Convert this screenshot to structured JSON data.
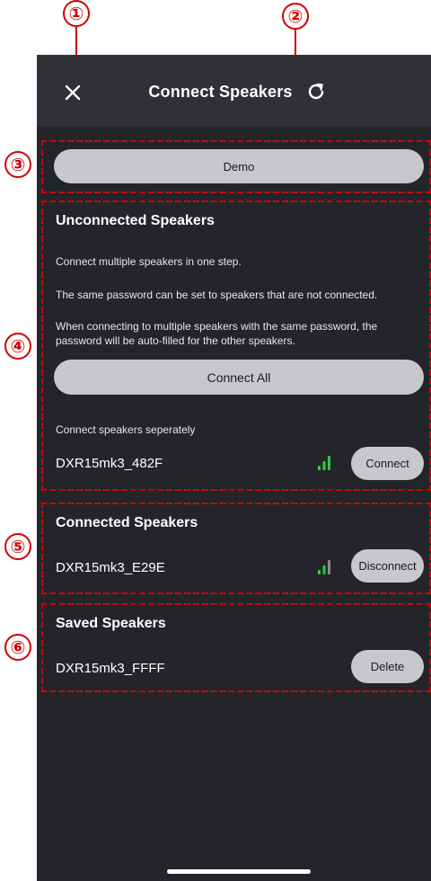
{
  "callouts": [
    "①",
    "②",
    "③",
    "④",
    "⑤",
    "⑥"
  ],
  "header": {
    "title": "Connect Speakers",
    "close_icon": "close-icon",
    "refresh_icon": "refresh-icon"
  },
  "demo": {
    "label": "Demo"
  },
  "unconnected": {
    "title": "Unconnected Speakers",
    "description1": "Connect multiple speakers in one step.",
    "description2": "The same password can be set to speakers that are not connected.",
    "description3": "When connecting to multiple speakers with the same password, the password will be auto-filled for the other speakers.",
    "connect_all_label": "Connect All",
    "separately_label": "Connect speakers seperately",
    "speakers": [
      {
        "name": "DXR15mk3_482F",
        "action": "Connect",
        "signal": "strong"
      }
    ]
  },
  "connected": {
    "title": "Connected Speakers",
    "speakers": [
      {
        "name": "DXR15mk3_E29E",
        "action": "Disconnect",
        "signal": "medium"
      }
    ]
  },
  "saved": {
    "title": "Saved Speakers",
    "speakers": [
      {
        "name": "DXR15mk3_FFFF",
        "action": "Delete"
      }
    ]
  },
  "colors": {
    "accent_red": "#d00000",
    "signal_green": "#2ecc40",
    "signal_gray": "#8a8a8e",
    "background": "#24252a"
  }
}
